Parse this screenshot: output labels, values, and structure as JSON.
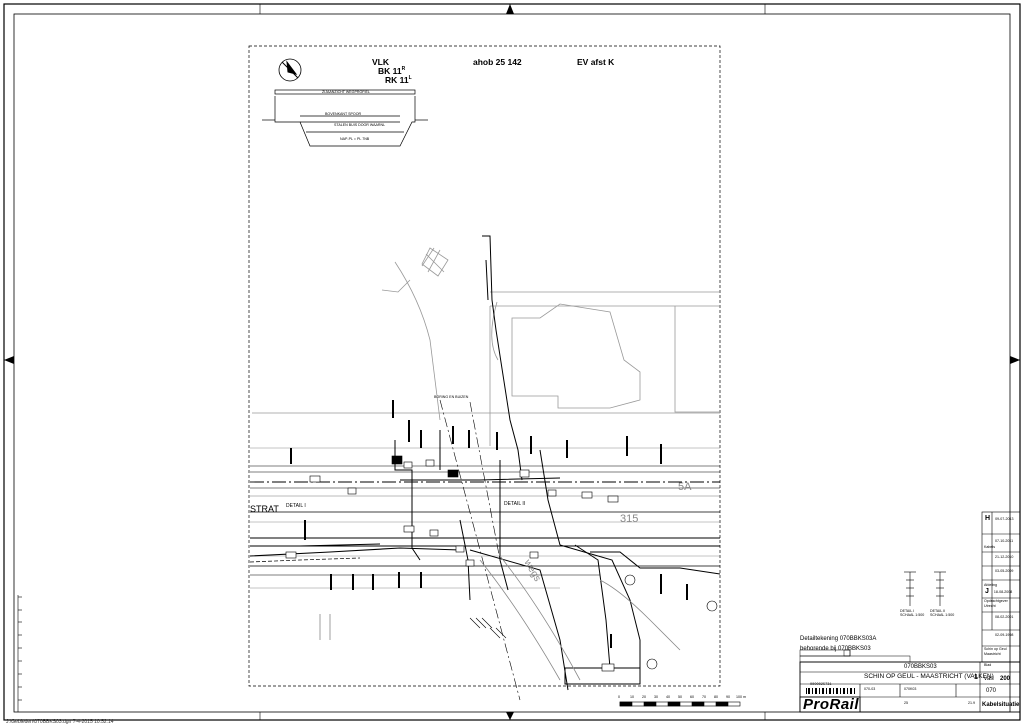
{
  "drawing": {
    "header": {
      "vlk": "VLK",
      "bk": "BK 11",
      "bk_sup": "R",
      "rk": "RK 11",
      "rk_sup": "L",
      "ahob": "ahob 25 142",
      "ev": "EV afst K"
    },
    "cross_section": {
      "top": "ZIJAANZICHT WEGPROFIEL",
      "mid": "BOVENKANT SPOOR",
      "low": "STALEN BUIS DOOR WAARNL",
      "bottom": "NAP-PL = PL 7NB"
    },
    "labels": {
      "detail_1": "DETAIL I",
      "detail_2": "DETAIL II",
      "street": "STRAT",
      "km_315": "315",
      "km_5a": "5A",
      "boring": "BORING EN BUIZEN",
      "waterway": "wegs"
    },
    "detail_ref": {
      "line1": "Detailtekening  070BBKS03A",
      "line2": "behorende bij    070BBKS03"
    },
    "symbols": {
      "s1": "DETAIL I\nSCHAAL 1:500",
      "s2": "DETAIL II\nSCHAAL 1:500"
    }
  },
  "title_block": {
    "drawing_no": "070BBKS03",
    "route": "SCHIN OP GEUL - MAASTRICHT  (VALKEN)",
    "sheet_label": "Blad",
    "sheet_of": "van",
    "sheet_num": "1",
    "sheet_total": "200",
    "number_code": "070",
    "code_a": "070-03",
    "code_b": "070K03",
    "page_ref": "25",
    "paper_size": "21.9",
    "type": "Kabelsituatie",
    "company": "ProRail",
    "barcode": "0000025731"
  },
  "revision_column": {
    "rows": [
      {
        "letter": "H",
        "date": "09-07-2013"
      },
      {
        "letter": "",
        "date": "07-10-2011"
      },
      {
        "letter": "",
        "date": "21-12-2010"
      },
      {
        "letter": "",
        "date": "03-05-2009"
      },
      {
        "letter": "J",
        "date": "18-08-2008"
      },
      {
        "letter": "",
        "date": "08-02-2001"
      },
      {
        "letter": "",
        "date": "02-09-1998"
      }
    ],
    "notes": [
      "Opdrachtgever",
      "Utrecht",
      "Schin op Geul",
      "Maastricht",
      "Kabels",
      "Afdeling"
    ]
  },
  "footer": {
    "path": "J:\\Gebieden\\070BBKS03.dgn   7-4-2015 10:52:14"
  },
  "scale_bar": {
    "ticks": [
      "0",
      "10",
      "20",
      "30",
      "40",
      "50",
      "60",
      "70",
      "80",
      "90",
      "100 m"
    ]
  }
}
